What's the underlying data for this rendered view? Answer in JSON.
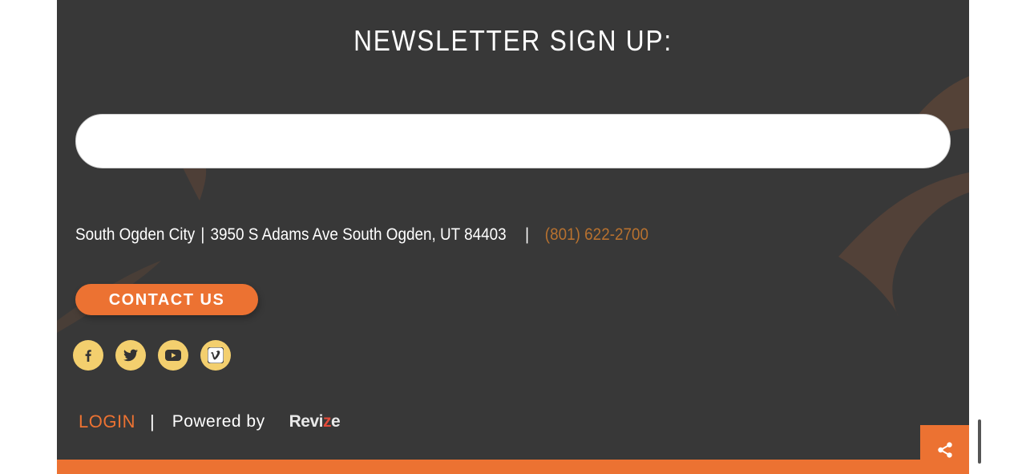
{
  "newsletter": {
    "title": "NEWSLETTER SIGN UP:",
    "input_value": "",
    "input_placeholder": ""
  },
  "contact_info": {
    "city": "South Ogden City",
    "separator": "|",
    "address": "3950 S Adams Ave South Ogden, UT 84403",
    "phone": "(801) 622-2700"
  },
  "contact_button": {
    "label": "CONTACT US"
  },
  "social": [
    {
      "name": "facebook-icon"
    },
    {
      "name": "twitter-icon"
    },
    {
      "name": "youtube-icon"
    },
    {
      "name": "vimeo-icon"
    }
  ],
  "bottom": {
    "login_label": "LOGIN",
    "separator": "|",
    "powered_by": "Powered by",
    "brand_prefix": "Revi",
    "brand_z": "z",
    "brand_suffix": "e"
  },
  "share": {
    "icon": "share-icon"
  },
  "colors": {
    "footer_bg": "#383838",
    "accent_orange": "#ec7232",
    "phone_color": "#b7712f",
    "social_yellow": "#f3cf6e"
  }
}
